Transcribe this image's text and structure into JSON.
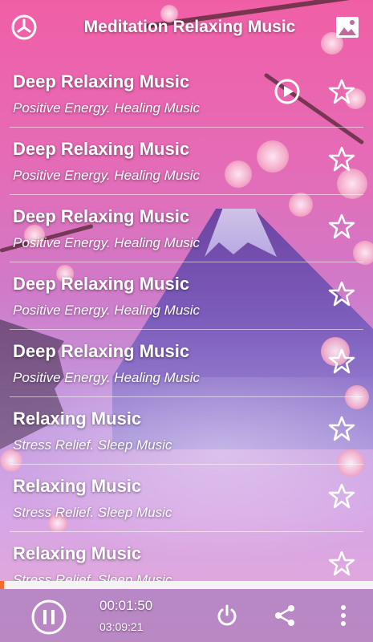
{
  "header": {
    "title": "Meditation Relaxing Music",
    "left_icon": "timer-icon",
    "right_icon": "image-icon"
  },
  "tracks": [
    {
      "title": "Deep Relaxing Music",
      "subtitle": "Positive Energy. Healing Music",
      "playing": true
    },
    {
      "title": "Deep Relaxing Music",
      "subtitle": "Positive Energy. Healing Music",
      "playing": false
    },
    {
      "title": "Deep Relaxing Music",
      "subtitle": "Positive Energy. Healing Music",
      "playing": false
    },
    {
      "title": "Deep Relaxing Music",
      "subtitle": "Positive Energy. Healing Music",
      "playing": false
    },
    {
      "title": "Deep Relaxing Music",
      "subtitle": "Positive Energy. Healing Music",
      "playing": false
    },
    {
      "title": "Relaxing Music",
      "subtitle": "Stress Relief. Sleep Music",
      "playing": false
    },
    {
      "title": "Relaxing Music",
      "subtitle": "Stress Relief. Sleep Music",
      "playing": false
    },
    {
      "title": "Relaxing Music",
      "subtitle": "Stress Relief. Sleep Music",
      "playing": false
    }
  ],
  "player": {
    "elapsed": "00:01:50",
    "total": "03:09:21",
    "progress_fraction": 0.01,
    "accent_color": "#f26a2e"
  },
  "colors": {
    "background_pink": "#f05fa6",
    "background_purple": "#c19be0"
  }
}
